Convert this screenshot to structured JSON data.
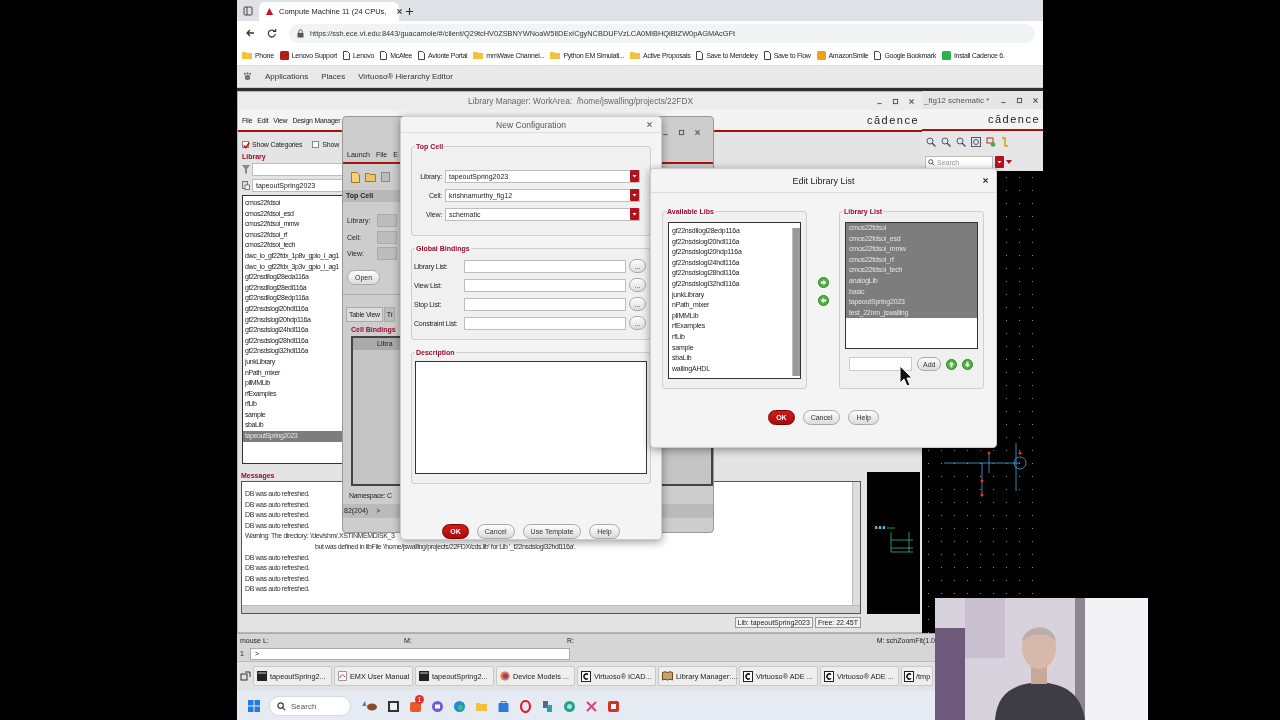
{
  "browser": {
    "tabs": [
      {
        "title": "Compute Machine 11 (24 CPUs,",
        "selected": true
      }
    ],
    "url": "https://ssh.ece.vt.edu:8443/guacamole/#/client/Q29tcHV0ZSBNYWNoaW5lIDExICgyNCBDUFVzLCA0MiBHQiBtZW0pAGMAcGFt",
    "bookmarks": [
      {
        "label": "Phone",
        "kind": "folder"
      },
      {
        "label": "Lenovo Support",
        "kind": "app",
        "color": "#b01c1c"
      },
      {
        "label": "Lenovo",
        "kind": "page"
      },
      {
        "label": "McAfee",
        "kind": "page"
      },
      {
        "label": "Avionte Portal",
        "kind": "page"
      },
      {
        "label": "mmWave Channel...",
        "kind": "folder"
      },
      {
        "label": "Python EM Simulati...",
        "kind": "folder"
      },
      {
        "label": "Active Proposals",
        "kind": "folder"
      },
      {
        "label": "Save to Mendeley",
        "kind": "page"
      },
      {
        "label": "Save to Flow",
        "kind": "page"
      },
      {
        "label": "AmazonSmile",
        "kind": "app",
        "color": "#f0a020"
      },
      {
        "label": "Google Bookmark",
        "kind": "page"
      },
      {
        "label": "Install Cadence 6.",
        "kind": "app",
        "color": "#2bb24c"
      }
    ]
  },
  "desktop_bar": {
    "items": [
      "Applications",
      "Places",
      "Virtuoso® Hierarchy Editor"
    ]
  },
  "library_manager": {
    "title": "Library Manager: WorkArea:  /home/jswalling/projects/22FDX",
    "menu": [
      "File",
      "Edit",
      "View",
      "Design Manager"
    ],
    "logo": "cādence",
    "options": [
      {
        "label": "Show Categories",
        "checked": true
      },
      {
        "label": "Show",
        "checked": false
      }
    ],
    "library_heading": "Library",
    "library_field": "tapeoutSpring2023",
    "libraries": [
      {
        "label": "cmos22fdsoi",
        "selected": false
      },
      {
        "label": "cmos22fdsoi_esd",
        "selected": false
      },
      {
        "label": "cmos22fdsoi_mmw",
        "selected": false
      },
      {
        "label": "cmos22fdsoi_rf",
        "selected": false
      },
      {
        "label": "cmos22fdsoi_tech",
        "selected": false
      },
      {
        "label": "dwc_io_gf22fdx_1p8v_gpio_i_ag1",
        "selected": false
      },
      {
        "label": "dwc_io_gf22fdx_3p3v_gpio_i_ag1",
        "selected": false
      },
      {
        "label": "gf22nsdllogl28eda116a",
        "selected": false
      },
      {
        "label": "gf22nsdllogl28edl116a",
        "selected": false
      },
      {
        "label": "gf22nsdllogl28edp116a",
        "selected": false
      },
      {
        "label": "gf22nsdslogl20hdl116a",
        "selected": false
      },
      {
        "label": "gf22nsdslogl20hdp116a",
        "selected": false
      },
      {
        "label": "gf22nsdslogl24hdl116a",
        "selected": false
      },
      {
        "label": "gf22nsdslogl28hdl116a",
        "selected": false
      },
      {
        "label": "gf22nsdslogl32hdl116a",
        "selected": false
      },
      {
        "label": "junkLibrary",
        "selected": false
      },
      {
        "label": "nPath_mixer",
        "selected": false
      },
      {
        "label": "pllMMLib",
        "selected": false
      },
      {
        "label": "rfExamples",
        "selected": false
      },
      {
        "label": "rfLib",
        "selected": false
      },
      {
        "label": "sample",
        "selected": false
      },
      {
        "label": "sbaLib",
        "selected": false
      },
      {
        "label": "tapeoutSpring2023",
        "selected": true
      }
    ],
    "messages_heading": "Messages",
    "messages": [
      {
        "text": "DB was auto refreshed.",
        "kind": "plain"
      },
      {
        "text": "DB was auto refreshed.",
        "kind": "plain"
      },
      {
        "text": "DB was auto refreshed.",
        "kind": "plain"
      },
      {
        "text": "DB was auto refreshed.",
        "kind": "plain"
      },
      {
        "text": "Warning: The directory: '/dev/shm/.XSTINMEMDISK_3",
        "kind": "plain"
      },
      {
        "text": "but was defined in libFile '/home/jswalling/projects/22FDX/cds.lib' for Lib '_f22nsdslogl32hdl116a'.",
        "kind": "continued"
      },
      {
        "text": "DB was auto refreshed.",
        "kind": "plain"
      },
      {
        "text": "DB was auto refreshed.",
        "kind": "plain"
      },
      {
        "text": "DB was auto refreshed.",
        "kind": "plain"
      },
      {
        "text": "DB was auto refreshed.",
        "kind": "plain"
      }
    ],
    "status": [
      "Lib: tapeoutSpring2023",
      "Free: 22.45T"
    ]
  },
  "hierarchy_editor": {
    "menu": [
      "Launch",
      "File",
      "E"
    ],
    "top_cell_heading": "Top Cell",
    "labels": [
      "Library:",
      "Cell:",
      "View:"
    ],
    "open_button": "Open",
    "tabs": [
      {
        "label": "Table View",
        "selected": true
      },
      {
        "label": "Tr",
        "selected": false
      }
    ],
    "bindings_heading": "Cell Bindings",
    "column": "Libra",
    "namespace": "Namespace: C",
    "count": "82(204)",
    "prompt": ">"
  },
  "new_config": {
    "title": "New Configuration",
    "top_cell": {
      "heading": "Top Cell",
      "fields": [
        {
          "label": "Library:",
          "value": "tapeoutSpring2023"
        },
        {
          "label": "Cell:",
          "value": "krishnamurthy_fig12"
        },
        {
          "label": "View:",
          "value": "schematic"
        }
      ]
    },
    "global_bindings": {
      "heading": "Global Bindings",
      "fields": [
        {
          "label": "Library List:",
          "button": "..."
        },
        {
          "label": "View List:",
          "button": "..."
        },
        {
          "label": "Stop List:",
          "button": "..."
        },
        {
          "label": "Constraint List:",
          "button": "..."
        }
      ]
    },
    "description_heading": "Description",
    "buttons": [
      {
        "label": "OK",
        "default": true
      },
      {
        "label": "Cancel",
        "default": false
      },
      {
        "label": "Use Template",
        "default": false
      },
      {
        "label": "Help",
        "default": false
      }
    ]
  },
  "edit_library_list": {
    "title": "Edit Library List",
    "available": {
      "heading": "Available Libs",
      "items": [
        {
          "label": "gf22nsdllogl28edp116a",
          "selected": false
        },
        {
          "label": "gf22nsdslogl20hdl116a",
          "selected": false
        },
        {
          "label": "gf22nsdslogl20hdp116a",
          "selected": false
        },
        {
          "label": "gf22nsdslogl24hdl116a",
          "selected": false
        },
        {
          "label": "gf22nsdslogl28hdl116a",
          "selected": false
        },
        {
          "label": "gf22nsdslogl32hdl116a",
          "selected": false
        },
        {
          "label": "junkLibrary",
          "selected": false
        },
        {
          "label": "nPath_mixer",
          "selected": false
        },
        {
          "label": "pllMMLib",
          "selected": false
        },
        {
          "label": "rfExamples",
          "selected": false
        },
        {
          "label": "rfLib",
          "selected": false
        },
        {
          "label": "sample",
          "selected": false
        },
        {
          "label": "sbaLib",
          "selected": false
        },
        {
          "label": "wallingAHDL",
          "selected": false
        }
      ]
    },
    "library_list": {
      "heading": "Library List",
      "items": [
        {
          "label": "cmos22fdsoi",
          "selected": true
        },
        {
          "label": "cmos22fdsoi_esd",
          "selected": true
        },
        {
          "label": "cmos22fdsoi_mmw",
          "selected": true
        },
        {
          "label": "cmos22fdsoi_rf",
          "selected": true
        },
        {
          "label": "cmos22fdsoi_tech",
          "selected": true
        },
        {
          "label": "analogLib",
          "selected": true
        },
        {
          "label": "basic",
          "selected": true
        },
        {
          "label": "tapeoutSpring2023",
          "selected": true
        },
        {
          "label": "test_22nm_jswalling",
          "selected": true
        }
      ]
    },
    "add_button": "Add",
    "buttons": [
      {
        "label": "OK",
        "default": true
      },
      {
        "label": "Cancel",
        "default": false
      },
      {
        "label": "Help",
        "default": false
      }
    ]
  },
  "schematic": {
    "title": "_fig12 schematic *",
    "logo": "cādence",
    "search_placeholder": "Search"
  },
  "command_strip": {
    "mouse": [
      "mouse L:",
      "M:",
      "R:"
    ],
    "hint": "M: schZoomFit(1.0",
    "line_number": "1",
    "prompt": ">"
  },
  "remote_taskbar": {
    "items": [
      {
        "label": "tapeoutSpring2...",
        "kind": "terminal"
      },
      {
        "label": "EMX User Manual",
        "kind": "document"
      },
      {
        "label": "tapeoutSpring2...",
        "kind": "terminal"
      },
      {
        "label": "Device Models ...",
        "kind": "browser"
      },
      {
        "label": "Virtuoso® ICAD...",
        "kind": "cadence"
      },
      {
        "label": "Library Manager:...",
        "kind": "book"
      },
      {
        "label": "Virtuoso® ADE ...",
        "kind": "cadence"
      },
      {
        "label": "Virtuoso® ADE ...",
        "kind": "cadence"
      },
      {
        "label": "/tmp",
        "kind": "cadence"
      }
    ]
  },
  "windows_taskbar": {
    "search_placeholder": "Search",
    "badge": "1"
  }
}
